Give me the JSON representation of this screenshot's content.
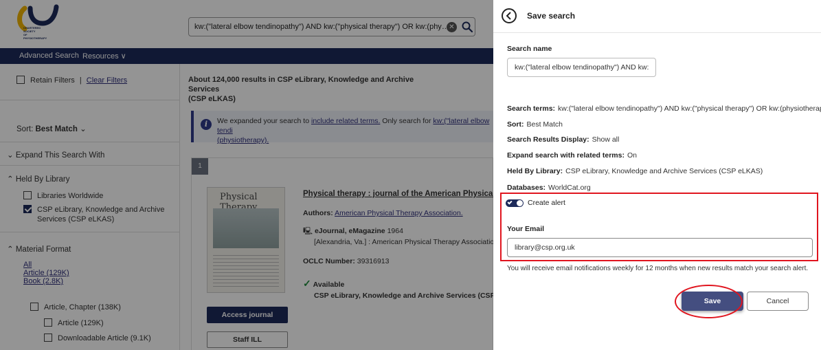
{
  "header": {
    "logo_text": [
      "CHARTERED",
      "SOCIETY",
      "OF",
      "PHYSIOTHERAPY"
    ],
    "search_query": "kw:(\"lateral elbow tendinopathy\") AND kw:(\"physical therapy\") OR kw:(physiot...",
    "clear_icon": "close-circle-icon",
    "search_icon": "magnifier-icon"
  },
  "nav": {
    "advanced_search": "Advanced Search",
    "resources": "Resources ∨"
  },
  "sidebar": {
    "retain_filters": "Retain Filters",
    "clear_filters": "Clear Filters",
    "sort_label": "Sort:",
    "sort_value": "Best Match",
    "expand_heading": "Expand This Search With",
    "held_by_heading": "Held By Library",
    "libraries_worldwide": "Libraries Worldwide",
    "csp_library_line1": "CSP eLibrary, Knowledge and Archive",
    "csp_library_line2": "Services (CSP eLKAS)",
    "material_heading": "Material Format",
    "fmt_all": "All",
    "fmt_article": "Article (129K)",
    "fmt_book": "Book (2.8K)",
    "fmt_article_chapter": "Article, Chapter (138K)",
    "fmt_article_sub": "Article (129K)",
    "fmt_downloadable": "Downloadable Article (9.1K)"
  },
  "results": {
    "count_line1": "About 124,000 results in CSP eLibrary, Knowledge and Archive Services",
    "count_line2": "(CSP eLKAS)",
    "expand_note_pre": "We expanded your search to ",
    "expand_note_link": "include related terms.",
    "expand_note_mid": " Only search for ",
    "expand_note_link2": "kw:(\"lateral elbow tendi",
    "expand_note_line2": "(physiotherapy).",
    "item_number": "1",
    "cover_title": "Physical Therapy",
    "item_title": "Physical therapy : journal of the American Physical The",
    "authors_label": "Authors:",
    "authors_value": "American Physical Therapy Association.",
    "format": "eJournal, eMagazine",
    "year": "1964",
    "publisher": "[Alexandria, Va.] : American Physical Therapy Association [C",
    "oclc_label": "OCLC Number:",
    "oclc_value": "39316913",
    "availability": "Available",
    "held_library": "CSP eLibrary, Knowledge and Archive Services (CSP eLKAS",
    "access_button": "Access journal",
    "ill_button": "Staff ILL"
  },
  "panel": {
    "title": "Save search",
    "search_name_label": "Search name",
    "search_name_value": "kw:(\"lateral elbow tendinopathy\") AND kw:(",
    "criteria": {
      "terms_label": "Search terms:",
      "terms_value": "kw:(\"lateral elbow tendinopathy\") AND kw:(\"physical therapy\") OR kw:(physiotherapy)",
      "sort_label": "Sort:",
      "sort_value": "Best Match",
      "display_label": "Search Results Display:",
      "display_value": "Show all",
      "expand_label": "Expand search with related terms:",
      "expand_value": "On",
      "held_label": "Held By Library:",
      "held_value": "CSP eLibrary, Knowledge and Archive Services (CSP eLKAS)",
      "db_label": "Databases:",
      "db_value": "WorldCat.org"
    },
    "create_alert_label": "Create alert",
    "create_alert_on": true,
    "email_label": "Your Email",
    "email_value": "library@csp.org.uk",
    "notify_text": "You will receive email notifications weekly for 12 months when new results match your search alert.",
    "save_button": "Save",
    "cancel_button": "Cancel"
  },
  "colors": {
    "navy": "#1d2a5a",
    "save_button": "#444e80",
    "highlight_red": "#e0141e",
    "logo_yellow": "#f0b400"
  }
}
